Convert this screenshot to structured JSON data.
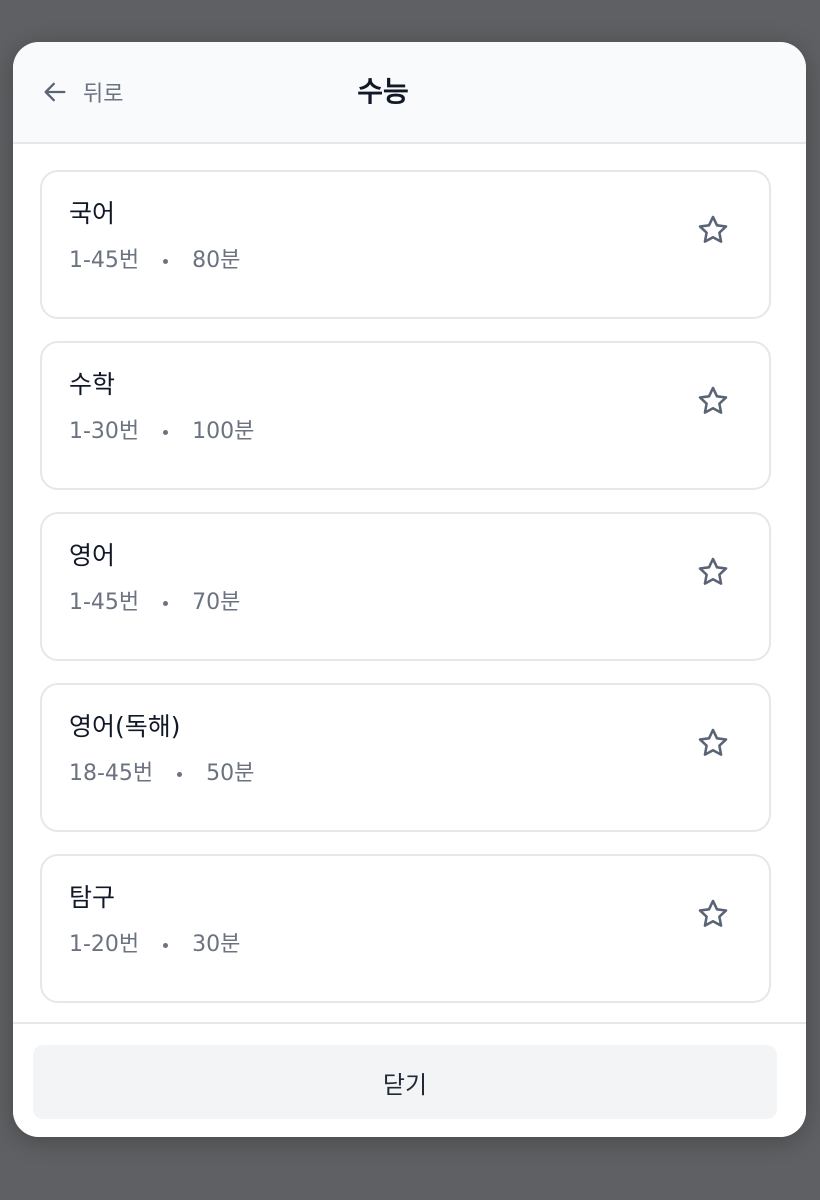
{
  "header": {
    "back_label": "뒤로",
    "title": "수능"
  },
  "subjects": [
    {
      "name": "국어",
      "range": "1-45번",
      "time": "80분",
      "starred": false
    },
    {
      "name": "수학",
      "range": "1-30번",
      "time": "100분",
      "starred": false
    },
    {
      "name": "영어",
      "range": "1-45번",
      "time": "70분",
      "starred": false
    },
    {
      "name": "영어(독해)",
      "range": "18-45번",
      "time": "50분",
      "starred": false
    },
    {
      "name": "탐구",
      "range": "1-20번",
      "time": "30분",
      "starred": false
    }
  ],
  "footer": {
    "close_label": "닫기"
  },
  "icons": {
    "back": "arrow-left-icon",
    "favorite": "star-outline-icon"
  },
  "colors": {
    "text_primary": "#111827",
    "text_secondary": "#6b7280",
    "icon": "#5b6475",
    "border": "#e5e7eb"
  }
}
